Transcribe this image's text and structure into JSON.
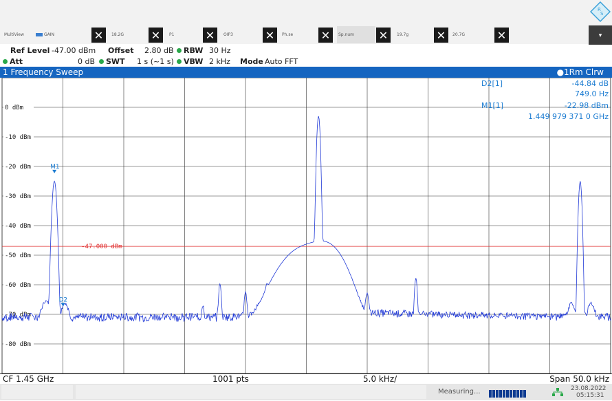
{
  "toolbar": {
    "tabs": [
      {
        "label": "MultiView"
      },
      {
        "label": "GAIN"
      },
      {
        "label": "18.2G"
      },
      {
        "label": "P1"
      },
      {
        "label": "OIP3"
      },
      {
        "label": "Ph.se"
      },
      {
        "label": "Sp.num"
      },
      {
        "label": "19.7g"
      },
      {
        "label": "20.7G"
      }
    ],
    "close_glyph": "✕",
    "dropdown_glyph": "▾"
  },
  "params": {
    "ref_level_label": "Ref Level",
    "ref_level_value": "-47.00 dBm",
    "offset_label": "Offset",
    "offset_value": "2.80 dB",
    "rbw_label": "RBW",
    "rbw_value": "30 Hz",
    "att_label": "Att",
    "att_value": "0 dB",
    "swt_label": "SWT",
    "swt_value": "1 s (~1 s)",
    "vbw_label": "VBW",
    "vbw_value": "2 kHz",
    "mode_label": "Mode",
    "mode_value": "Auto FFT"
  },
  "sweep": {
    "title": "1 Frequency Sweep",
    "trace": "●1Rm Clrw"
  },
  "markers_table": [
    {
      "name": "D2[1]",
      "level": "-44.84 dB",
      "freq": "749.0 Hz"
    },
    {
      "name": "M1[1]",
      "level": "-22.98 dBm",
      "freq": "1.449 979 371 0 GHz"
    }
  ],
  "chart_data": {
    "type": "line",
    "ylim": [
      -90,
      10
    ],
    "y_ticks": [
      "0 dBm",
      "-10 dBm",
      "-20 dBm",
      "-30 dBm",
      "-40 dBm",
      "-50 dBm",
      "-60 dBm",
      "-70 dBm",
      "-80 dBm"
    ],
    "display_line": {
      "label": "-47.000 dBm",
      "value": -47
    },
    "markers": [
      {
        "label": "M1",
        "x_div": 0.86,
        "y": -23
      },
      {
        "label": "D2",
        "x_div": 1.0,
        "y": -68
      }
    ],
    "x_divisions": 10,
    "center_frequency": "CF 1.45 GHz",
    "points": "1001 pts",
    "per_div": "5.0 kHz/",
    "span": "Span 50.0 kHz",
    "noise_floor_dbm": -71,
    "peaks": [
      {
        "x_div": 0.86,
        "y": -25,
        "width": 0.02
      },
      {
        "x_div": 0.72,
        "y": -67,
        "width": 0.05
      },
      {
        "x_div": 1.03,
        "y": -68,
        "width": 0.04
      },
      {
        "x_div": 3.3,
        "y": -69,
        "width": 0.015
      },
      {
        "x_div": 3.58,
        "y": -60,
        "width": 0.015
      },
      {
        "x_div": 4.0,
        "y": -63,
        "width": 0.015
      },
      {
        "x_div": 4.35,
        "y": -65,
        "width": 0.015
      },
      {
        "x_div": 5.0,
        "y": -47,
        "width": 0.25
      },
      {
        "x_div": 5.2,
        "y": -3,
        "width": 0.015
      },
      {
        "x_div": 5.33,
        "y": -47,
        "width": 0.18
      },
      {
        "x_div": 6.0,
        "y": -64,
        "width": 0.02
      },
      {
        "x_div": 6.8,
        "y": -58,
        "width": 0.015
      },
      {
        "x_div": 9.36,
        "y": -68,
        "width": 0.04
      },
      {
        "x_div": 9.5,
        "y": -25,
        "width": 0.015
      },
      {
        "x_div": 9.68,
        "y": -68,
        "width": 0.04
      }
    ]
  },
  "status": {
    "measuring": "Measuring...",
    "date": "23.08.2022",
    "time": "05:15:31"
  }
}
